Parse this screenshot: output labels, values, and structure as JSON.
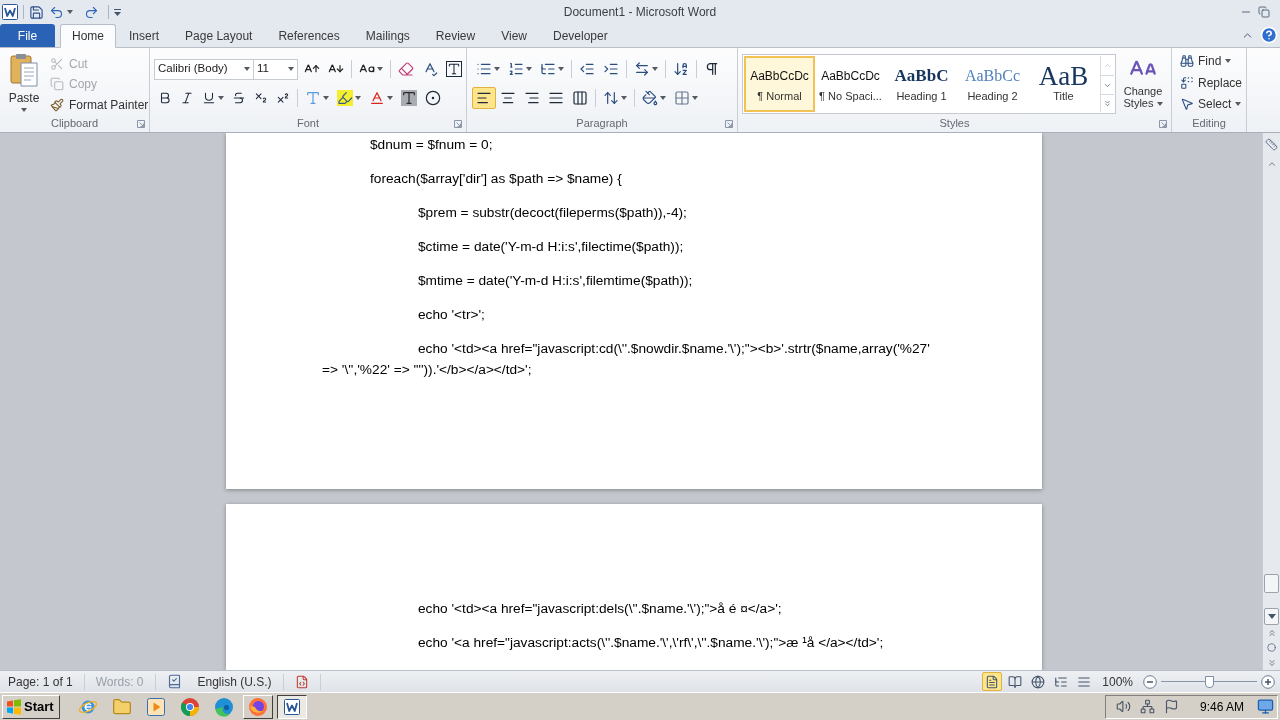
{
  "window": {
    "title": "Document1 - Microsoft Word"
  },
  "tabs": [
    {
      "label": "File",
      "kind": "file",
      "selected": false
    },
    {
      "label": "Home",
      "kind": "tab",
      "selected": true
    },
    {
      "label": "Insert",
      "kind": "tab",
      "selected": false
    },
    {
      "label": "Page Layout",
      "kind": "tab",
      "selected": false
    },
    {
      "label": "References",
      "kind": "tab",
      "selected": false
    },
    {
      "label": "Mailings",
      "kind": "tab",
      "selected": false
    },
    {
      "label": "Review",
      "kind": "tab",
      "selected": false
    },
    {
      "label": "View",
      "kind": "tab",
      "selected": false
    },
    {
      "label": "Developer",
      "kind": "tab",
      "selected": false
    }
  ],
  "clipboard": {
    "title": "Clipboard",
    "paste": "Paste",
    "commands": [
      {
        "kind": "cut",
        "label": "Cut",
        "disabled": true
      },
      {
        "kind": "copy",
        "label": "Copy",
        "disabled": true
      },
      {
        "kind": "painter",
        "label": "Format Painter",
        "disabled": false
      }
    ]
  },
  "font": {
    "title": "Font",
    "font_name": "Calibri (Body)",
    "font_size": "11"
  },
  "paragraph": {
    "title": "Paragraph",
    "alignments": [
      {
        "kind": "left",
        "selected": true
      },
      {
        "kind": "center",
        "selected": false
      },
      {
        "kind": "right",
        "selected": false
      },
      {
        "kind": "justify",
        "selected": false
      },
      {
        "kind": "distributed",
        "selected": false
      }
    ]
  },
  "styles": {
    "title": "Styles",
    "gallery": [
      {
        "kind": "normal",
        "preview": "AaBbCcDc",
        "name": "¶ Normal",
        "selected": true
      },
      {
        "kind": "normal",
        "preview": "AaBbCcDc",
        "name": "¶ No Spaci...",
        "selected": false
      },
      {
        "kind": "heading1",
        "preview": "AaBbC",
        "name": "Heading 1",
        "selected": false
      },
      {
        "kind": "heading2",
        "preview": "AaBbCc",
        "name": "Heading 2",
        "selected": false
      },
      {
        "kind": "title",
        "preview": "AaB",
        "name": "Title",
        "selected": false
      }
    ],
    "change_styles": "Change Styles"
  },
  "editing": {
    "title": "Editing",
    "commands": [
      {
        "kind": "find",
        "label": "Find"
      },
      {
        "kind": "replace",
        "label": "Replace"
      },
      {
        "kind": "select",
        "label": "Select"
      }
    ]
  },
  "document": {
    "pages": [
      {
        "lines": [
          {
            "kind": "outer",
            "text": "$dnum = $fnum = 0;"
          },
          {
            "kind": "outer",
            "text": "foreach($array['dir'] as $path => $name) {"
          },
          {
            "kind": "inner",
            "text": "$prem = substr(decoct(fileperms($path)),-4);"
          },
          {
            "kind": "inner",
            "text": "$ctime = date('Y-m-d H:i:s',filectime($path));"
          },
          {
            "kind": "inner",
            "text": "$mtime = date('Y-m-d H:i:s',filemtime($path));"
          },
          {
            "kind": "inner",
            "text": "echo '<tr>';"
          },
          {
            "kind": "inner",
            "text": "echo '<td><a href=\"javascript:cd(\\''.$nowdir.$name.'\\');\"><b>'.strtr($name,array('%27' => '\\'','%22' => '\"')).'</b></a></td>';"
          }
        ]
      },
      {
        "lines": [
          {
            "kind": "inner",
            "text": "echo '<td><a href=\"javascript:dels(\\''.$name.'\\');\">å é ¤</a>';"
          },
          {
            "kind": "inner",
            "text": "echo '<a href=\"javascript:acts(\\''.$name.'\\',\\'rf\\',\\''.$name.'\\');\">æ ¹å </a></td>';"
          }
        ]
      }
    ]
  },
  "status_bar": {
    "page": "Page: 1 of 1",
    "words": {
      "label": "Words: 0",
      "disabled": true
    },
    "language": "English (U.S.)",
    "views": [
      {
        "kind": "print",
        "selected": true
      },
      {
        "kind": "reading",
        "selected": false
      },
      {
        "kind": "web",
        "selected": false
      },
      {
        "kind": "outline",
        "selected": false
      },
      {
        "kind": "draft",
        "selected": false
      }
    ],
    "zoom": "100%",
    "zoom_slider": {
      "level": 0.5
    }
  },
  "taskbar": {
    "start": "Start",
    "apps": [
      {
        "kind": "ie",
        "open": false,
        "selected": false
      },
      {
        "kind": "explorer",
        "open": false,
        "selected": false
      },
      {
        "kind": "media",
        "open": false,
        "selected": false
      },
      {
        "kind": "chrome",
        "open": false,
        "selected": false
      },
      {
        "kind": "edge",
        "open": false,
        "selected": false
      },
      {
        "kind": "firefox",
        "open": true,
        "selected": false
      },
      {
        "kind": "word",
        "open": true,
        "selected": true
      }
    ],
    "clock": "9:46 AM"
  }
}
